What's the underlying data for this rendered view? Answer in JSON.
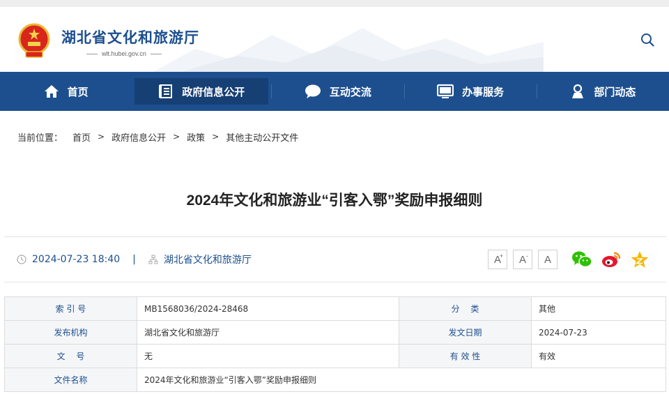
{
  "header": {
    "title": "湖北省文化和旅游厅",
    "domain": "wlt.hubei.gov.cn"
  },
  "nav": [
    {
      "label": "首页",
      "icon": "home-icon"
    },
    {
      "label": "政府信息公开",
      "icon": "document-list-icon"
    },
    {
      "label": "互动交流",
      "icon": "chat-bubble-icon"
    },
    {
      "label": "办事服务",
      "icon": "monitor-icon"
    },
    {
      "label": "部门动态",
      "icon": "person-icon"
    }
  ],
  "breadcrumb": {
    "lead": "当前位置：",
    "items": [
      "首页",
      "政府信息公开",
      "政策",
      "其他主动公开文件"
    ],
    "separator": ">"
  },
  "article": {
    "title": "2024年文化和旅游业“引客入鄂”奖励申报细则",
    "datetime": "2024-07-23 18:40",
    "divider": "|",
    "source": "湖北省文化和旅游厅"
  },
  "font_controls": {
    "increase": "A",
    "increase_mark": "+",
    "decrease": "A",
    "decrease_mark": "-",
    "reset": "A"
  },
  "share": [
    "wechat-icon",
    "weibo-icon",
    "favorite-star-icon"
  ],
  "info": {
    "index_label": "索 引 号",
    "index_value": "MB1568036/2024-28468",
    "category_label": "分　 类",
    "category_value": "其他",
    "publisher_label": "发布机构",
    "publisher_value": "湖北省文化和旅游厅",
    "issue_date_label": "发文日期",
    "issue_date_value": "2024-07-23",
    "doc_no_label": "文　 号",
    "doc_no_value": "无",
    "validity_label": "有 效 性",
    "validity_value": "有效",
    "filename_label": "文件名称",
    "filename_value": "2024年文化和旅游业“引客入鄂”奖励申报细则"
  },
  "colors": {
    "brand": "#1d4f8f",
    "nav_active": "#163f74",
    "wechat": "#2dc100",
    "weibo": "#e6162d",
    "star": "#f5b800"
  }
}
